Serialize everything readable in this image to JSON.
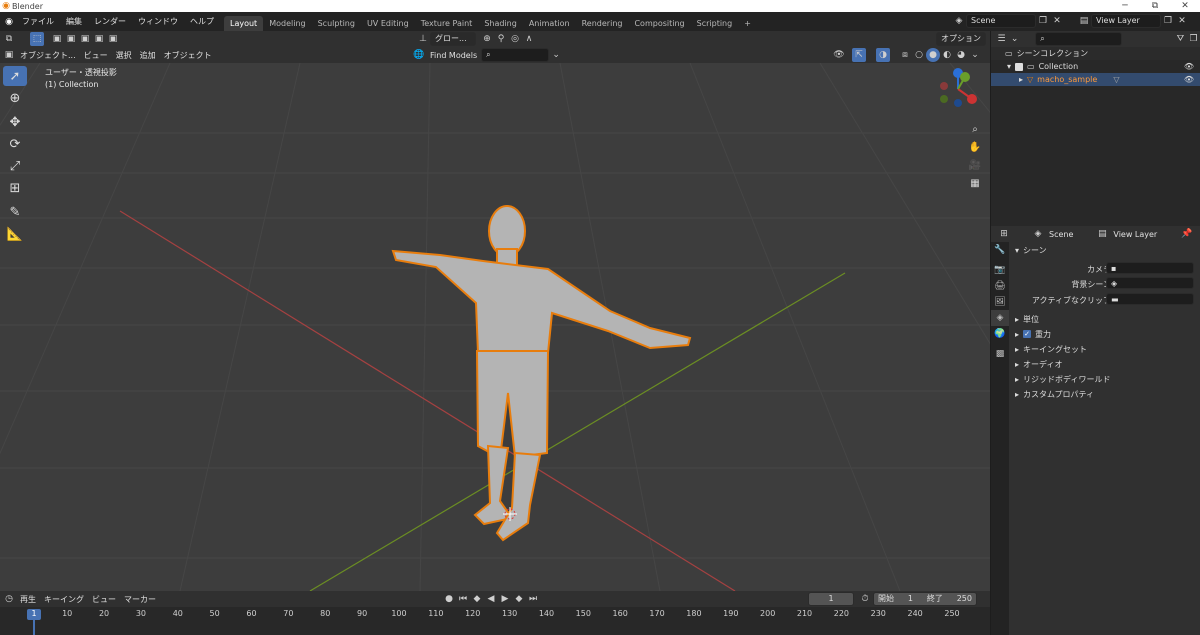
{
  "window": {
    "title": "Blender",
    "min": "─",
    "max": "⧉",
    "close": "✕"
  },
  "menu": {
    "items": [
      "ファイル",
      "編集",
      "レンダー",
      "ウィンドウ",
      "ヘルプ"
    ],
    "workspaces": [
      "Layout",
      "Modeling",
      "Sculpting",
      "UV Editing",
      "Texture Paint",
      "Shading",
      "Animation",
      "Rendering",
      "Compositing",
      "Scripting"
    ],
    "add_tab": "+",
    "scene": "Scene",
    "view_layer": "View Layer"
  },
  "viewport_header": {
    "mode": "オブジェクト...",
    "menus": [
      "ビュー",
      "選択",
      "追加",
      "オブジェクト"
    ],
    "orientation": "グロー...",
    "find_models": "Find Models",
    "options": "オプション"
  },
  "viewport": {
    "view_name": "ユーザー・透視投影",
    "collection": "(1) Collection",
    "gizmo": {
      "x": "X",
      "y": "Y",
      "z": "Z"
    }
  },
  "outliner": {
    "root": "シーンコレクション",
    "collection": "Collection",
    "object": "macho_sample"
  },
  "properties": {
    "header_scene": "Scene",
    "header_view_layer": "View Layer",
    "section": "シーン",
    "fields": [
      {
        "label": "カメラ",
        "value": ""
      },
      {
        "label": "背景シーン",
        "value": ""
      },
      {
        "label": "アクティブなクリップ",
        "value": ""
      }
    ],
    "panels": [
      "単位",
      "重力",
      "キーイングセット",
      "オーディオ",
      "リジッドボディワールド",
      "カスタムプロパティ"
    ],
    "gravity_checked": true
  },
  "timeline": {
    "menus": [
      "再生",
      "キーイング",
      "ビュー",
      "マーカー"
    ],
    "current_frame": "1",
    "start_label": "開始",
    "start": "1",
    "end_label": "終了",
    "end": "250",
    "ruler": [
      "1",
      "10",
      "20",
      "30",
      "40",
      "50",
      "60",
      "70",
      "80",
      "90",
      "100",
      "110",
      "120",
      "130",
      "140",
      "150",
      "160",
      "170",
      "180",
      "190",
      "200",
      "210",
      "220",
      "230",
      "240",
      "250"
    ]
  },
  "colors": {
    "accent": "#4772b3",
    "selection": "#e87d0d",
    "x_axis": "#a54141",
    "y_axis": "#6b8e23"
  }
}
